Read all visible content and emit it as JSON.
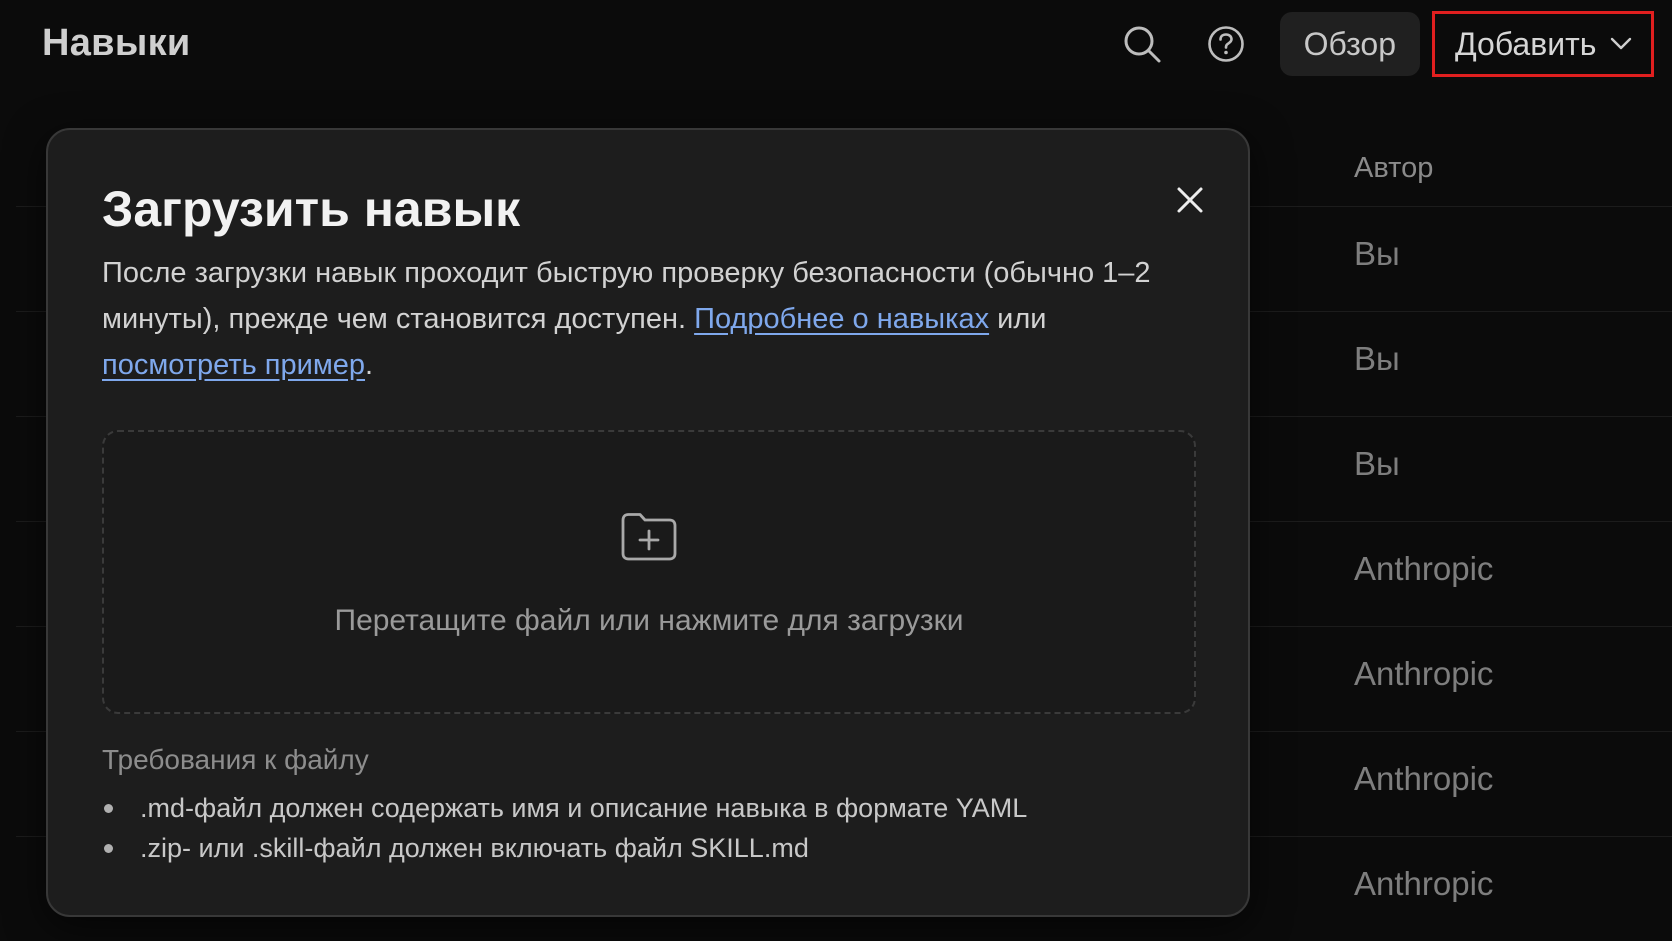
{
  "header": {
    "title": "Навыки",
    "search_icon": "search-icon",
    "help_icon": "question-circle-icon",
    "overview_label": "Обзор",
    "add_label": "Добавить",
    "add_icon": "chevron-down-icon",
    "highlight_color": "#e11f1f"
  },
  "table": {
    "author_header": "Автор",
    "rows": [
      {
        "author": "Вы"
      },
      {
        "author": "Вы"
      },
      {
        "author": "Вы"
      },
      {
        "author": "Anthropic"
      },
      {
        "author": "Anthropic"
      },
      {
        "author": "Anthropic"
      },
      {
        "author": "Anthropic"
      }
    ]
  },
  "modal": {
    "title": "Загрузить навык",
    "close_icon": "close-icon",
    "description_text": "После загрузки навык проходит быструю проверку безопасности (обычно 1–2 минуты), прежде чем становится доступен. ",
    "link_learn_more": "Подробнее о навыках",
    "connector": " или ",
    "link_example": "посмотреть пример",
    "end_punct": ".",
    "link_color": "#7fa8ec",
    "dropzone": {
      "icon": "folder-plus-icon",
      "text": "Перетащите файл или нажмите для загрузки"
    },
    "requirements": {
      "title": "Требования к файлу",
      "items": [
        ".md-файл должен содержать имя и описание навыка в формате YAML",
        ".zip- или .skill-файл должен включать файл SKILL.md"
      ]
    }
  }
}
